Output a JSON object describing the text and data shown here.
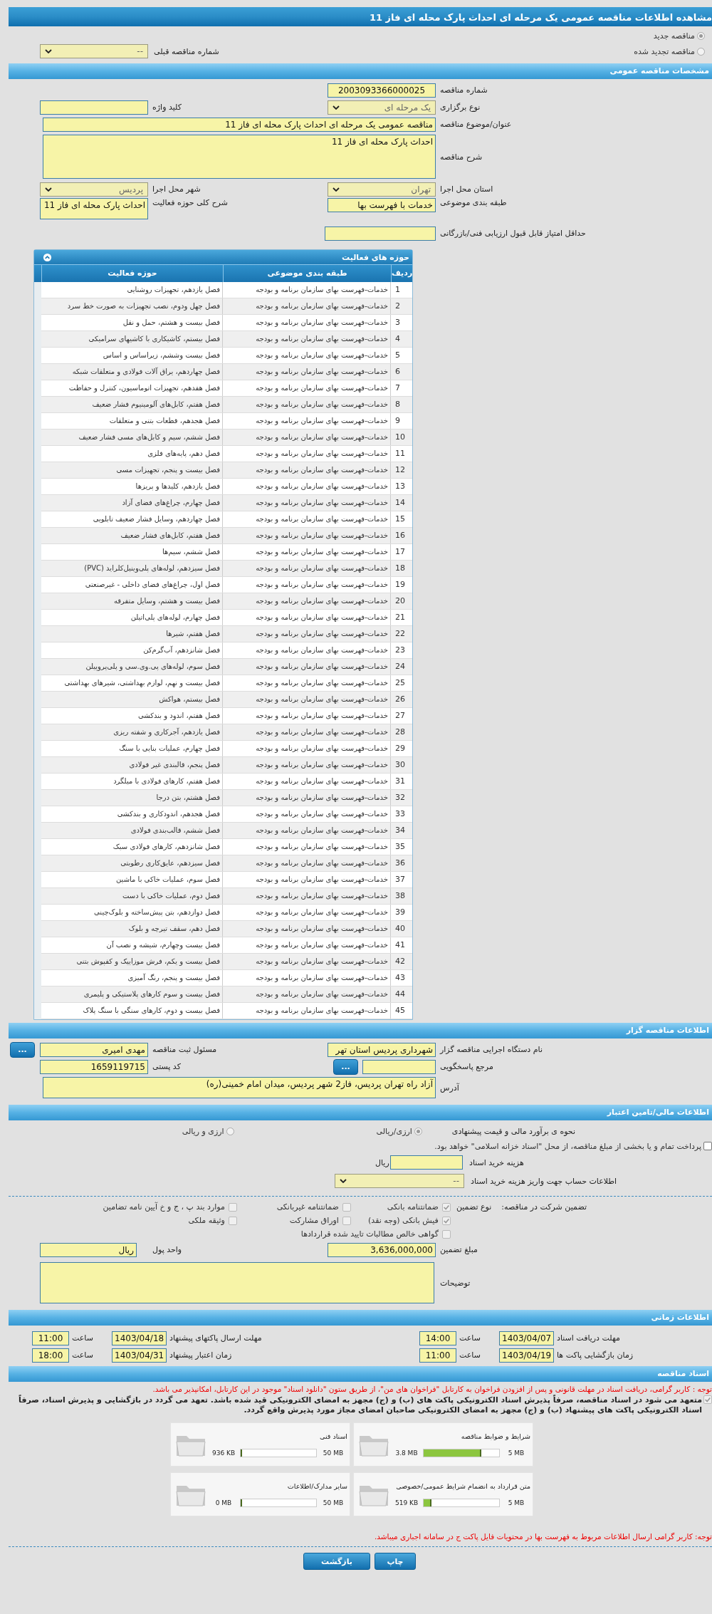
{
  "window": {
    "title": "مشاهده اطلاعات مناقصه عمومی یک مرحله ای احداث پارک محله ای فاز 11"
  },
  "tender_type": [
    {
      "label": "مناقصه جدید",
      "selected": true
    },
    {
      "label": "مناقصه تجدید شده",
      "selected": false
    }
  ],
  "previous_tender": {
    "label": "شماره مناقصه قبلی",
    "value": "--"
  },
  "general": {
    "title": "مشخصات مناقصه عمومی",
    "tender_number": {
      "label": "شماره مناقصه",
      "value": "2003093366000025"
    },
    "holding_type": {
      "label": "نوع برگزاری",
      "value": "یک مرحله ای"
    },
    "keyword": {
      "label": "کلید واژه"
    },
    "subject": {
      "label": "عنوان/موضوع مناقصه",
      "value": "مناقصه عمومی یک مرحله ای احداث پارک محله ای فاز 11"
    },
    "description": {
      "label": "شرح مناقصه",
      "value": "احداث پارک محله ای فاز 11"
    },
    "province": {
      "label": "استان محل اجرا",
      "value": "تهران"
    },
    "city": {
      "label": "شهر محل اجرا",
      "value": "پردیس"
    },
    "category": {
      "label": "طبقه بندی موضوعی",
      "value": "خدمات با فهرست بها"
    },
    "activity_scope": {
      "label": "شرح کلی حوزه فعالیت",
      "value": "احداث پارک محله ای فاز 11"
    },
    "min_score": {
      "label": "حداقل امتیاز قابل قبول ارزیابی فنی/بازرگانی"
    }
  },
  "activities": {
    "title": "حوزه های فعالیت",
    "columns": [
      "ردیف",
      "طبقه بندی موضوعی",
      "حوزه فعالیت"
    ],
    "rows": [
      [
        "1",
        "خدمات-فهرست بهای سازمان برنامه و بودجه",
        "فصل یازدهم، تجهیزات روشنایی"
      ],
      [
        "2",
        "خدمات-فهرست بهای سازمان برنامه و بودجه",
        "فصل چهل ودوم، نصب تجهیزات به صورت خط سرد"
      ],
      [
        "3",
        "خدمات-فهرست بهای سازمان برنامه و بودجه",
        "فصل بیست و هشتم، حمل و نقل"
      ],
      [
        "4",
        "خدمات-فهرست بهای سازمان برنامه و بودجه",
        "فصل بیستم، کاشیکاری با کاشیهای سرامیکی"
      ],
      [
        "5",
        "خدمات-فهرست بهای سازمان برنامه و بودجه",
        "فصل بیست وششم، زیراساس و اساس"
      ],
      [
        "6",
        "خدمات-فهرست بهای سازمان برنامه و بودجه",
        "فصل چهاردهم، یراق آلات فولادی و متعلقات شبکه"
      ],
      [
        "7",
        "خدمات-فهرست بهای سازمان برنامه و بودجه",
        "فصل هفدهم، تجهیزات اتوماسیون، کنترل و حفاظت"
      ],
      [
        "8",
        "خدمات-فهرست بهای سازمان برنامه و بودجه",
        "فصل هفتم، کابل‌های آلومینیوم فشار ضعیف"
      ],
      [
        "9",
        "خدمات-فهرست بهای سازمان برنامه و بودجه",
        "فصل هجدهم، قطعات بتنی و متعلقات"
      ],
      [
        "10",
        "خدمات-فهرست بهای سازمان برنامه و بودجه",
        "فصل ششم، سیم و کابل‌های مسی فشار ضعیف"
      ],
      [
        "11",
        "خدمات-فهرست بهای سازمان برنامه و بودجه",
        "فصل دهم، پایه‌های فلزی"
      ],
      [
        "12",
        "خدمات-فهرست بهای سازمان برنامه و بودجه",
        "فصل بیست و پنجم، تجهیزات مسی"
      ],
      [
        "13",
        "خدمات-فهرست بهای سازمان برنامه و بودجه",
        "فصل یازدهم، کلیدها و پریزها"
      ],
      [
        "14",
        "خدمات-فهرست بهای سازمان برنامه و بودجه",
        "فصل چهارم، چراغ‌های فضای آزاد"
      ],
      [
        "15",
        "خدمات-فهرست بهای سازمان برنامه و بودجه",
        "فصل چهاردهم، وسایل فشار ضعیف تابلویی"
      ],
      [
        "16",
        "خدمات-فهرست بهای سازمان برنامه و بودجه",
        "فصل هفتم، کابل‌های فشار ضعیف"
      ],
      [
        "17",
        "خدمات-فهرست بهای سازمان برنامه و بودجه",
        "فصل ششم، سیم‌ها"
      ],
      [
        "18",
        "خدمات-فهرست بهای سازمان برنامه و بودجه",
        "فصل سیزدهم، لوله‌های پلی‌وینیل‌کلراید (PVC)"
      ],
      [
        "19",
        "خدمات-فهرست بهای سازمان برنامه و بودجه",
        "فصل اول، چراغ‌های فضای داخلی - غیرصنعتی"
      ],
      [
        "20",
        "خدمات-فهرست بهای سازمان برنامه و بودجه",
        "فصل بیست و هشتم، وسایل متفرقه"
      ],
      [
        "21",
        "خدمات-فهرست بهای سازمان برنامه و بودجه",
        "فصل چهارم، لوله‌های پلی‌اتیلن"
      ],
      [
        "22",
        "خدمات-فهرست بهای سازمان برنامه و بودجه",
        "فصل هفتم، شیرها"
      ],
      [
        "23",
        "خدمات-فهرست بهای سازمان برنامه و بودجه",
        "فصل شانزدهم، آب‌گرم‌کن"
      ],
      [
        "24",
        "خدمات-فهرست بهای سازمان برنامه و بودجه",
        "فصل سوم، لوله‌های پی.وی.سی و پلی‌پروپیلن"
      ],
      [
        "25",
        "خدمات-فهرست بهای سازمان برنامه و بودجه",
        "فصل بیست و نهم، لوازم بهداشتی، شیرهای بهداشتی"
      ],
      [
        "26",
        "خدمات-فهرست بهای سازمان برنامه و بودجه",
        "فصل بیستم، هواکش"
      ],
      [
        "27",
        "خدمات-فهرست بهای سازمان برنامه و بودجه",
        "فصل هفتم، اندود و بندکشی"
      ],
      [
        "28",
        "خدمات-فهرست بهای سازمان برنامه و بودجه",
        "فصل یازدهم، آجرکاری و شفته ریزی"
      ],
      [
        "29",
        "خدمات-فهرست بهای سازمان برنامه و بودجه",
        "فصل چهارم، عملیات بنایی با سنگ"
      ],
      [
        "30",
        "خدمات-فهرست بهای سازمان برنامه و بودجه",
        "فصل پنجم، قالبندی غیر فولادی"
      ],
      [
        "31",
        "خدمات-فهرست بهای سازمان برنامه و بودجه",
        "فصل هفتم، کارهای فولادی با میلگرد"
      ],
      [
        "32",
        "خدمات-فهرست بهای سازمان برنامه و بودجه",
        "فصل هشتم، بتن درجا"
      ],
      [
        "33",
        "خدمات-فهرست بهای سازمان برنامه و بودجه",
        "فصل هجدهم، اندودکاری و بندکشی"
      ],
      [
        "34",
        "خدمات-فهرست بهای سازمان برنامه و بودجه",
        "فصل ششم، قالب‌بندی فولادی"
      ],
      [
        "35",
        "خدمات-فهرست بهای سازمان برنامه و بودجه",
        "فصل شانزدهم، کارهای فولادی سبک"
      ],
      [
        "36",
        "خدمات-فهرست بهای سازمان برنامه و بودجه",
        "فصل سیزدهم، عایق‌کاری رطوبتی"
      ],
      [
        "37",
        "خدمات-فهرست بهای سازمان برنامه و بودجه",
        "فصل سوم، عملیات خاکی با ماشین"
      ],
      [
        "38",
        "خدمات-فهرست بهای سازمان برنامه و بودجه",
        "فصل دوم، عملیات خاکی با دست"
      ],
      [
        "39",
        "خدمات-فهرست بهای سازمان برنامه و بودجه",
        "فصل دوازدهم، بتن پیش‌ساخته و بلوک‌چینی"
      ],
      [
        "40",
        "خدمات-فهرست بهای سازمان برنامه و بودجه",
        "فصل دهم، سقف تیرچه و بلوک"
      ],
      [
        "41",
        "خدمات-فهرست بهای سازمان برنامه و بودجه",
        "فصل بیست وچهارم، شیشه و نصب آن"
      ],
      [
        "42",
        "خدمات-فهرست بهای سازمان برنامه و بودجه",
        "فصل بیست و یکم، فرش موزاییک و کفپوش بتنی"
      ],
      [
        "43",
        "خدمات-فهرست بهای سازمان برنامه و بودجه",
        "فصل بیست و پنجم، رنگ آمیزی"
      ],
      [
        "44",
        "خدمات-فهرست بهای سازمان برنامه و بودجه",
        "فصل بیست و سوم کارهای پلاستیکی و پلیمری"
      ],
      [
        "45",
        "خدمات-فهرست بهای سازمان برنامه و بودجه",
        "فصل بیست و دوم، کارهای سنگی با سنگ پلاک"
      ]
    ]
  },
  "organizer": {
    "title": "اطلاعات مناقصه گزار",
    "org_name": {
      "label": "نام دستگاه اجرایی مناقصه گزار",
      "value": "شهرداری پردیس استان تهر"
    },
    "registrar": {
      "label": "مسئول ثبت مناقصه",
      "value": "مهدی امیری",
      "button": "..."
    },
    "reference": {
      "label": "مرجع پاسخگویی",
      "button": "..."
    },
    "postal_code": {
      "label": "کد پستی",
      "value": "1659119715"
    },
    "address": {
      "label": "آدرس",
      "value": "آزاد راه تهران پردیس، فاز2 شهر پردیس، میدان امام خمینی(ره)"
    }
  },
  "finance": {
    "title": "اطلاعات مالی/تامین اعتبار",
    "estimate_label": "نحوه ی برآورد مالی و قیمت پیشنهادی",
    "estimate_options": [
      {
        "label": "ارزی/ریالی",
        "selected": true
      },
      {
        "label": "ارزی و ریالی",
        "selected": false
      }
    ],
    "treasury": {
      "label": "پرداخت تمام و یا بخشی از مبلغ مناقصه، از محل \"اسناد خزانه اسلامی\" خواهد بود.",
      "checked": false
    },
    "doc_cost": {
      "label": "هزینه خرید اسناد",
      "unit": "ریال"
    },
    "account": {
      "label": "اطلاعات حساب جهت واریز هزینه خرید اسناد",
      "value": "--"
    }
  },
  "guarantee": {
    "title": "تضمین شرکت در مناقصه:",
    "type_label": "نوع تضمین",
    "options": [
      {
        "label": "ضمانتنامه بانکی",
        "checked": true
      },
      {
        "label": "ضمانتنامه غیربانکی",
        "checked": false
      },
      {
        "label": "موارد بند پ ، ج و خ آیین نامه تضامین",
        "checked": false
      },
      {
        "label": "فیش بانکی (وجه نقد)",
        "checked": true
      },
      {
        "label": "اوراق مشارکت",
        "checked": false
      },
      {
        "label": "وثیقه ملکی",
        "checked": false
      },
      {
        "label": "گواهی خالص مطالبات تایید شده قراردادها",
        "checked": false
      }
    ],
    "amount": {
      "label": "مبلغ تضمین",
      "value": "3,636,000,000"
    },
    "currency": {
      "label": "واحد پول",
      "value": "ریال"
    },
    "notes": {
      "label": "توضیحات"
    }
  },
  "schedule": {
    "title": "اطلاعات زمانی",
    "items": [
      {
        "label": "مهلت دریافت اسناد",
        "date": "1403/04/07",
        "time_label": "ساعت",
        "time": "14:00"
      },
      {
        "label": "مهلت ارسال پاکتهای پیشنهاد",
        "date": "1403/04/18",
        "time_label": "ساعت",
        "time": "11:00"
      },
      {
        "label": "زمان بازگشایی پاکت ها",
        "date": "1403/04/19",
        "time_label": "ساعت",
        "time": "11:00"
      },
      {
        "label": "زمان اعتبار پیشنهاد",
        "date": "1403/04/31",
        "time_label": "ساعت",
        "time": "18:00"
      }
    ]
  },
  "documents": {
    "title": "اسناد مناقصه",
    "notice": "توجه : کاربر گرامی، دریافت اسناد در مهلت قانونی و پس از افزودن فراخوان به کارتابل \"فراخوان های من\"، از طریق ستون \"دانلود اسناد\" موجود در این کارتابل، امکانپذیر می باشد.",
    "commitment": {
      "label": "متعهد می شود در اسناد مناقصه، صرفاً پذیرش اسناد الکترونیکی پاکت های (ب) و (ج) مجهز به امضای الکترونیکی قید شده باشد. تعهد می گردد در بازگشایی و پذیرش اسناد، صرفاً اسناد الکترونیکی پاکت های پیشنهاد (ب) و (ج) مجهز به امضای الکترونیکی صاحبان امضای مجاز مورد پذیرش واقع گردد.",
      "checked": true
    },
    "files": [
      {
        "title": "شرایط و ضوابط مناقصه",
        "size": "3.8 MB",
        "max": "5 MB",
        "level": 0.76
      },
      {
        "title": "اسناد فنی",
        "size": "936 KB",
        "max": "50 MB",
        "level": 0.02
      },
      {
        "title": "متن قرارداد به انضمام شرایط عمومی/خصوصی",
        "size": "519 KB",
        "max": "5 MB",
        "level": 0.1
      },
      {
        "title": "سایر مدارک/اطلاعات",
        "size": "0 MB",
        "max": "50 MB",
        "level": 0
      }
    ],
    "footnote": "توجه: کاربر گرامی ارسال اطلاعات مربوط به فهرست بها در محتویات فایل پاکت ج در سامانه اجباری میباشد."
  },
  "buttons": [
    {
      "label": "چاپ"
    },
    {
      "label": "بازگشت"
    }
  ]
}
